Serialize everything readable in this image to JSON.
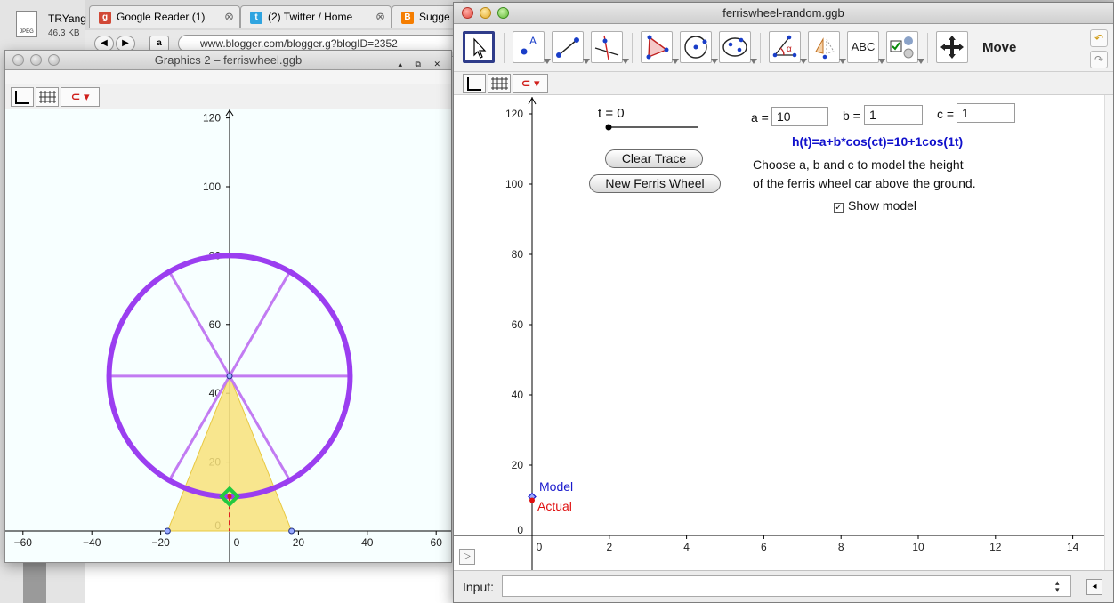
{
  "browser": {
    "download": {
      "name": "TRYang",
      "size": "46.3 KB",
      "type": "JPEG"
    },
    "tabs": [
      {
        "label": "Google Reader (1)",
        "close": "⊗",
        "favicon_text": "g",
        "color": "#d14836"
      },
      {
        "label": "(2) Twitter / Home",
        "close": "⊗",
        "favicon_text": "t",
        "color": "#2fa4e0"
      },
      {
        "label": "Sugge",
        "close": "",
        "favicon_text": "B",
        "color": "#f57d00"
      }
    ],
    "back": "◀",
    "forward": "▶",
    "amazon": "a",
    "url": "www.blogger.com/blogger.g?blogID=2352"
  },
  "graphics2": {
    "title": "Graphics 2 – ferriswheel.ggb",
    "controls": "▴ ⧉ ✕",
    "style_buttons": [
      "axes-toggle",
      "grid-toggle",
      "magnet"
    ],
    "magnet_symbol": "⊂ ▾",
    "x_ticks": [
      "−60",
      "−40",
      "−20",
      "0",
      "20",
      "40",
      "60"
    ],
    "y_ticks": [
      "120",
      "100",
      "80",
      "60",
      "40",
      "20",
      "0"
    ],
    "wheel": {
      "center": [
        0,
        45
      ],
      "radius": 35,
      "spokes": 6,
      "rim_color": "#9b3ef0",
      "spoke_color": "#c27bf2",
      "support_base": [
        -18,
        18
      ],
      "support_color": "#f8e27a",
      "car": [
        0,
        10
      ],
      "car_color": "#22c940"
    }
  },
  "main": {
    "title": "ferriswheel-random.ggb",
    "mode_label": "Move",
    "undo": "↶",
    "redo": "↷",
    "tools": [
      "move-tool",
      "point-tool",
      "line-tool",
      "perpendicular-tool",
      "polygon-tool",
      "circle-tool",
      "conic-tool",
      "angle-tool",
      "reflect-tool",
      "text-tool",
      "checkbox-tool",
      "move-view-tool"
    ],
    "text_tool_label": "ABC",
    "magnet_symbol": "⊂ ▾",
    "slider": {
      "label": "t = 0",
      "value": 0
    },
    "buttons": {
      "clear_trace": "Clear Trace",
      "new_wheel": "New Ferris Wheel"
    },
    "params": [
      {
        "label": "a =",
        "value": "10"
      },
      {
        "label": "b =",
        "value": "1"
      },
      {
        "label": "c =",
        "value": "1"
      }
    ],
    "formula": "h(t)=a+b*cos(ct)=10+1cos(1t)",
    "description": [
      "Choose a, b and c to model the height",
      "of the ferris wheel car above the ground."
    ],
    "checkbox": {
      "label": "Show model",
      "checked": true,
      "mark": "✓"
    },
    "legend": {
      "model": {
        "label": "Model",
        "color": "#1a1acc"
      },
      "actual": {
        "label": "Actual",
        "color": "#e01010"
      }
    },
    "model_point": [
      0,
      11
    ],
    "actual_point": [
      0,
      10
    ],
    "x_ticks": [
      "0",
      "2",
      "4",
      "6",
      "8",
      "10",
      "12",
      "14"
    ],
    "y_ticks": [
      "120",
      "100",
      "80",
      "60",
      "40",
      "20",
      "0"
    ],
    "play_symbol": "▷",
    "input": {
      "label": "Input:",
      "value": "",
      "arrows": "▴▾",
      "help": "◂"
    }
  }
}
